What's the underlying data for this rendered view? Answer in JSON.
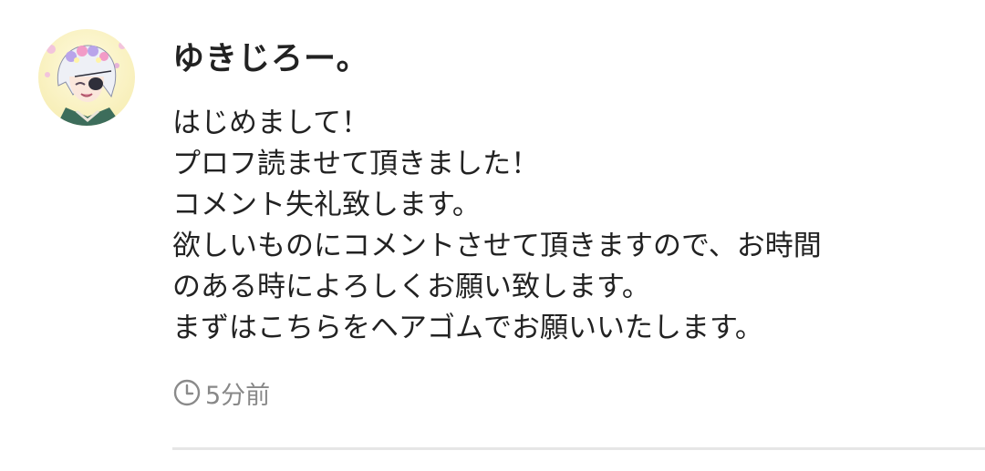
{
  "comment": {
    "avatar_icon": "user-avatar",
    "username": "ゆきじろー。",
    "body_lines": [
      "はじめまして！",
      "プロフ読ませて頂きました！",
      "コメント失礼致します。",
      "欲しいものにコメントさせて頂きますので、お時間",
      "のある時によろしくお願い致します。",
      "まずはこちらをヘアゴムでお願いいたします。"
    ],
    "timestamp_icon": "clock-icon",
    "timestamp": "5分前"
  },
  "colors": {
    "text": "#222222",
    "muted": "#888888",
    "divider": "#e6e6e6",
    "background": "#ffffff"
  }
}
